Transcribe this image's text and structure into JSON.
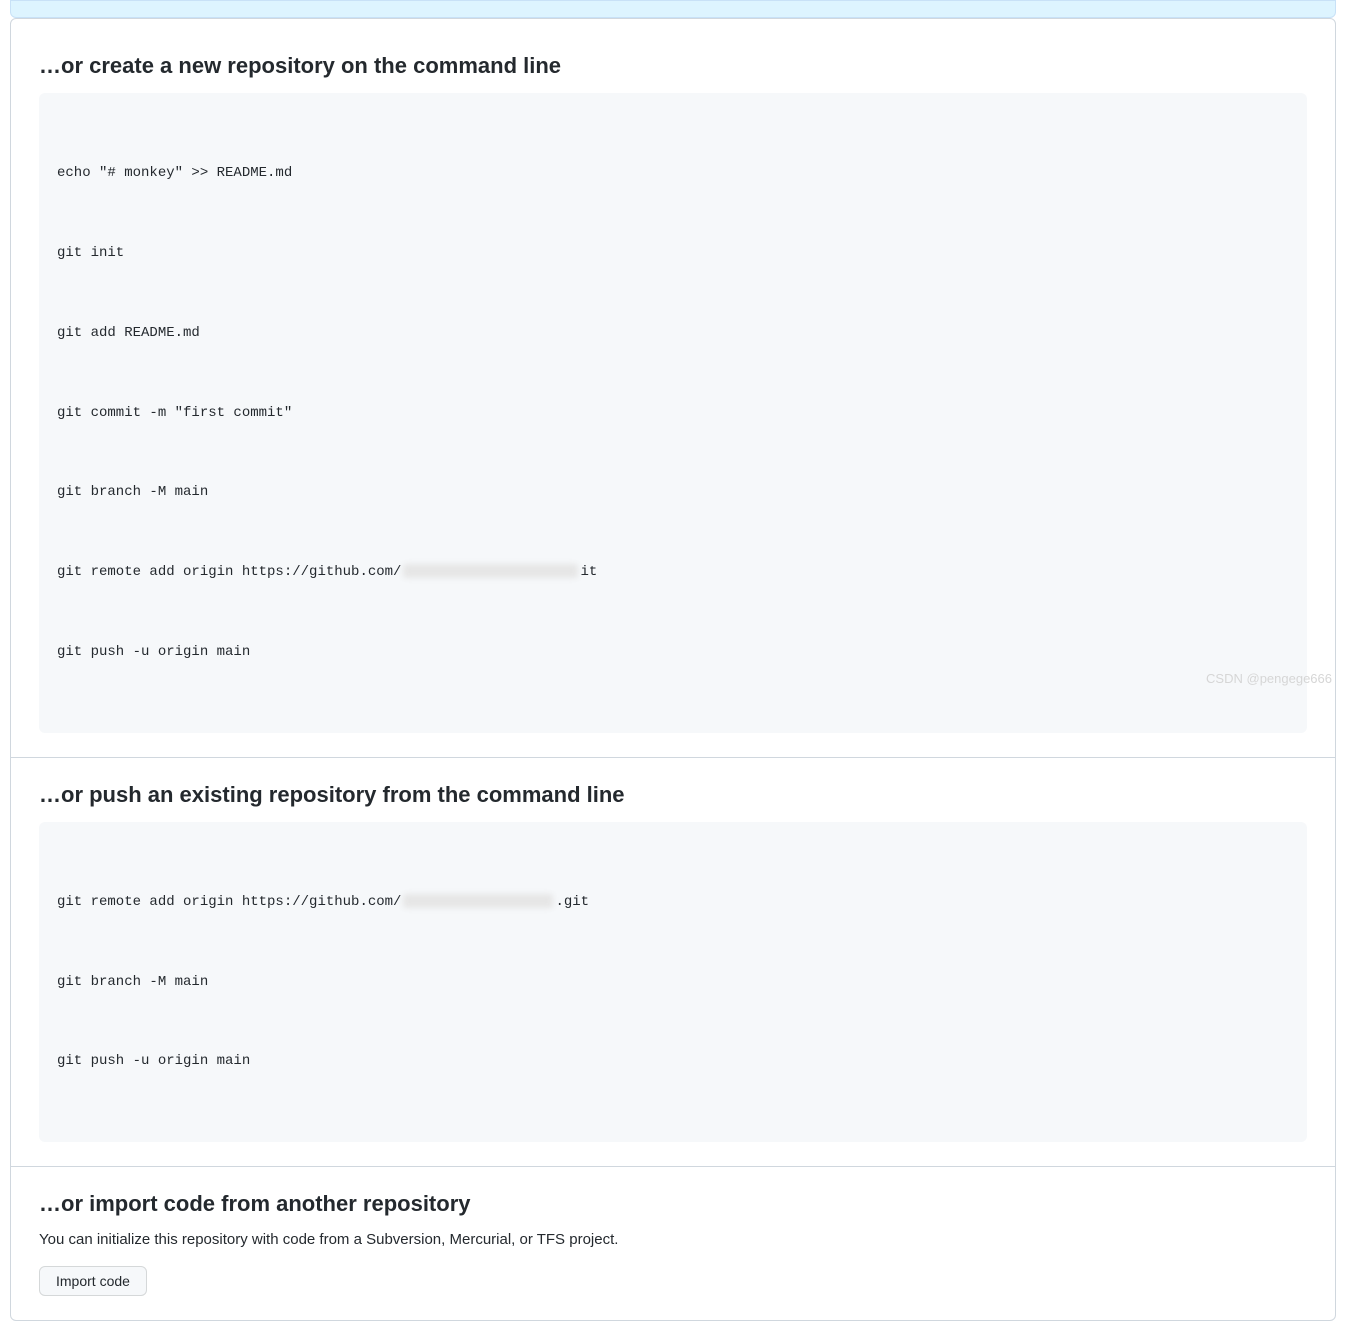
{
  "sections": {
    "create": {
      "heading": "…or create a new repository on the command line",
      "code": {
        "line1": "echo \"# monkey\" >> README.md",
        "line2": "git init",
        "line3": "git add README.md",
        "line4": "git commit -m \"first commit\"",
        "line5": "git branch -M main",
        "line6_prefix": "git remote add origin https://github.com/",
        "line6_suffix": "it",
        "line7": "git push -u origin main"
      }
    },
    "push": {
      "heading": "…or push an existing repository from the command line",
      "code": {
        "line1_prefix": "git remote add origin https://github.com/",
        "line1_suffix": ".git",
        "line2": "git branch -M main",
        "line3": "git push -u origin main"
      }
    },
    "import": {
      "heading": "…or import code from another repository",
      "description": "You can initialize this repository with code from a Subversion, Mercurial, or TFS project.",
      "button_label": "Import code"
    }
  },
  "watermark": "CSDN @pengege666"
}
